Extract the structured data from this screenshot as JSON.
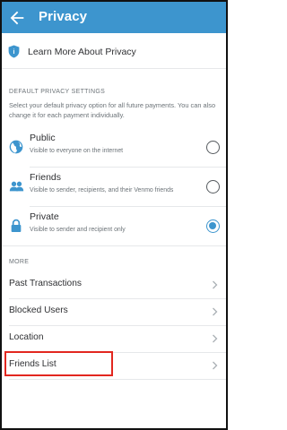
{
  "header": {
    "title": "Privacy",
    "back_icon": "arrow-left-icon"
  },
  "learn_more": {
    "label": "Learn More About Privacy",
    "icon": "shield-icon"
  },
  "default_settings": {
    "heading": "DEFAULT PRIVACY SETTINGS",
    "description": "Select your default privacy option for all future payments. You can also change it for each payment individually.",
    "options": [
      {
        "title": "Public",
        "subtitle": "Visible to everyone on the internet",
        "icon": "globe-icon",
        "selected": false
      },
      {
        "title": "Friends",
        "subtitle": "Visible to sender, recipients, and their Venmo friends",
        "icon": "people-icon",
        "selected": false
      },
      {
        "title": "Private",
        "subtitle": "Visible to sender and recipient only",
        "icon": "lock-icon",
        "selected": true
      }
    ]
  },
  "more": {
    "heading": "MORE",
    "items": [
      {
        "label": "Past Transactions"
      },
      {
        "label": "Blocked Users"
      },
      {
        "label": "Location"
      },
      {
        "label": "Friends List"
      }
    ]
  },
  "colors": {
    "brand": "#3d95ce",
    "highlight": "#e2271f"
  }
}
